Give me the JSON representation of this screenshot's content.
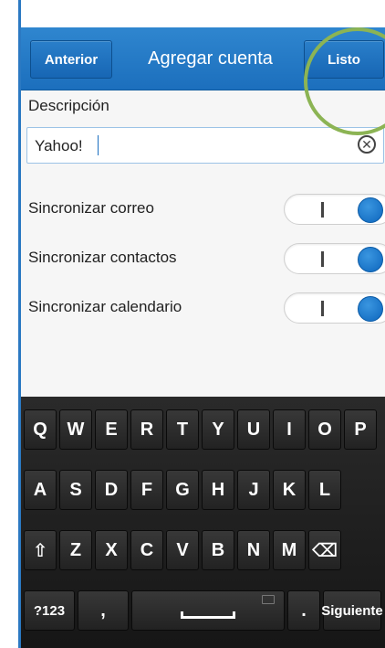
{
  "header": {
    "back_label": "Anterior",
    "title": "Agregar cuenta",
    "done_label": "Listo"
  },
  "form": {
    "description_label": "Descripción",
    "description_value": "Yahoo!",
    "clear_icon": "⊗",
    "rows": [
      {
        "label": "Sincronizar correo",
        "toggle_mark": "I",
        "state": "on"
      },
      {
        "label": "Sincronizar contactos",
        "toggle_mark": "I",
        "state": "on"
      },
      {
        "label": "Sincronizar calendario",
        "toggle_mark": "I",
        "state": "on"
      }
    ]
  },
  "keyboard": {
    "row1": [
      "Q",
      "W",
      "E",
      "R",
      "T",
      "Y",
      "U",
      "I",
      "O",
      "P"
    ],
    "row2": [
      "A",
      "S",
      "D",
      "F",
      "G",
      "H",
      "J",
      "K",
      "L"
    ],
    "row3": [
      "⇧",
      "Z",
      "X",
      "C",
      "V",
      "B",
      "N",
      "M",
      "⌫"
    ],
    "row4": {
      "symbols": "?123",
      "comma": ",",
      "period": ".",
      "next": "Siguiente"
    }
  },
  "colors": {
    "header": "#1c6fbd",
    "toggle_on": "#0d66bd",
    "highlight": "#8cb454"
  }
}
